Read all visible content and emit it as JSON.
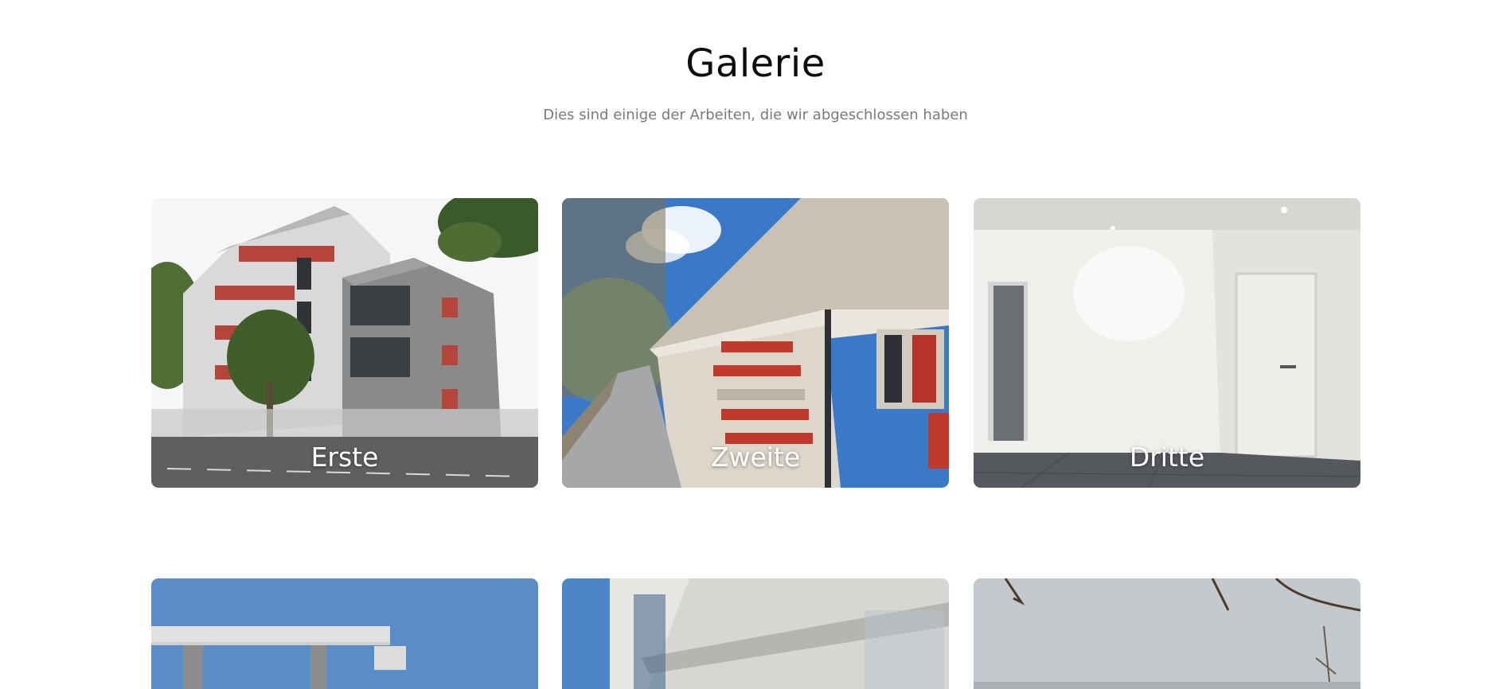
{
  "gallery": {
    "title": "Galerie",
    "subtitle": "Dies sind einige der Arbeiten, die wir abgeschlossen haben",
    "items": [
      {
        "label": "Erste"
      },
      {
        "label": "Zweite"
      },
      {
        "label": "Dritte"
      }
    ]
  },
  "colors": {
    "title": "#0d0d0d",
    "subtitle": "#7a7a7a",
    "background": "#ffffff",
    "label": "#ffffff"
  }
}
